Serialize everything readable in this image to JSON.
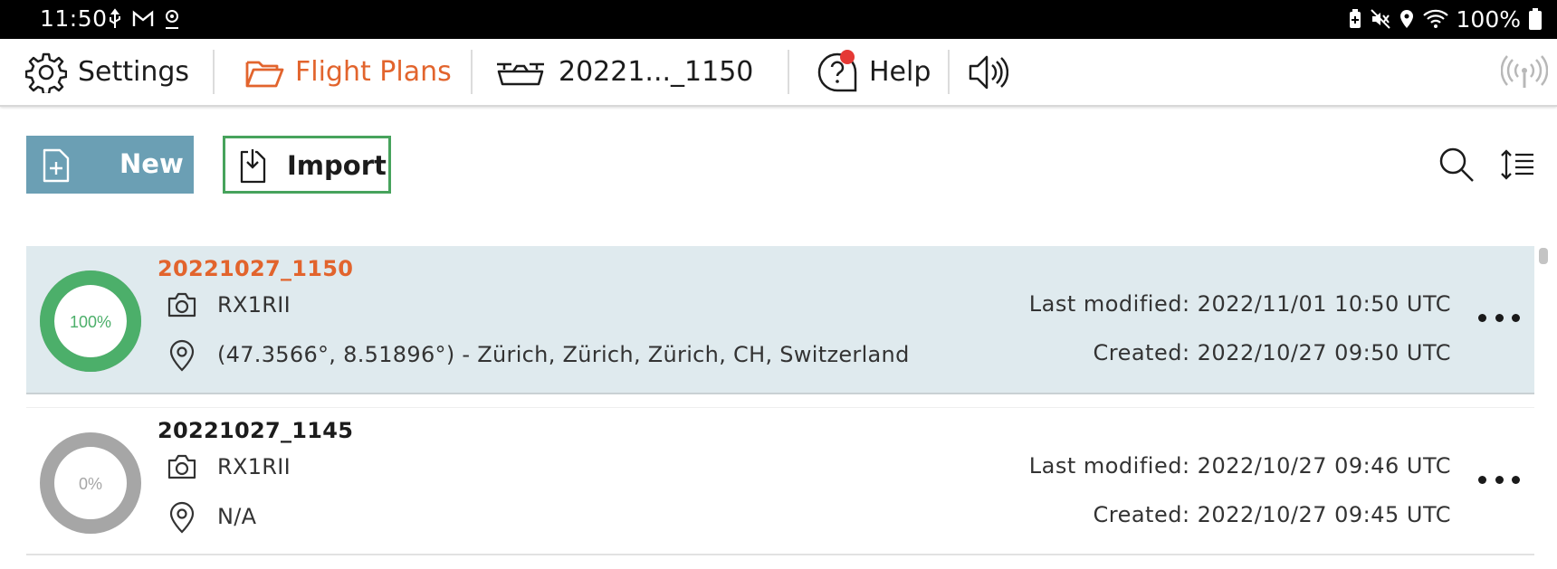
{
  "statusbar": {
    "time": "11:50",
    "battery_text": "100%"
  },
  "nav": {
    "settings_label": "Settings",
    "flight_plans_label": "Flight Plans",
    "plan_label": "20221..._1150",
    "help_label": "Help"
  },
  "toolbar": {
    "new_label": "New",
    "import_label": "Import"
  },
  "colors": {
    "accent_orange": "#e2642d",
    "new_button": "#6b9fb4",
    "import_border": "#47a35c",
    "progress_complete": "#4caf6a",
    "progress_empty": "#a6a6a6",
    "selected_row": "#dfeaee"
  },
  "plans": [
    {
      "title": "20221027_1150",
      "progress_text": "100%",
      "progress": 1.0,
      "camera": "RX1RII",
      "location": "(47.3566°, 8.51896°) - Zürich, Zürich, Zürich, CH, Switzerland",
      "last_modified": "Last modified: 2022/11/01 10:50 UTC",
      "created": "Created: 2022/10/27 09:50 UTC",
      "selected": true
    },
    {
      "title": "20221027_1145",
      "progress_text": "0%",
      "progress": 0.0,
      "camera": "RX1RII",
      "location": "N/A",
      "last_modified": "Last modified: 2022/10/27 09:46 UTC",
      "created": "Created: 2022/10/27 09:45 UTC",
      "selected": false
    }
  ],
  "icons": {
    "statusbar_left": [
      "usb-icon",
      "gmail-icon",
      "location-pin-icon"
    ],
    "statusbar_right": [
      "battery-saver-icon",
      "mute-icon",
      "location-icon",
      "wifi-icon",
      "battery-icon"
    ],
    "nav": [
      "gear-icon",
      "folder-icon",
      "drone-icon",
      "help-bubble-icon",
      "speaker-icon",
      "signal-antenna-icon"
    ],
    "toolbar": [
      "new-file-icon",
      "import-file-icon",
      "search-icon",
      "sort-icon"
    ],
    "row": [
      "camera-icon",
      "map-pin-icon",
      "more-options-icon"
    ]
  }
}
